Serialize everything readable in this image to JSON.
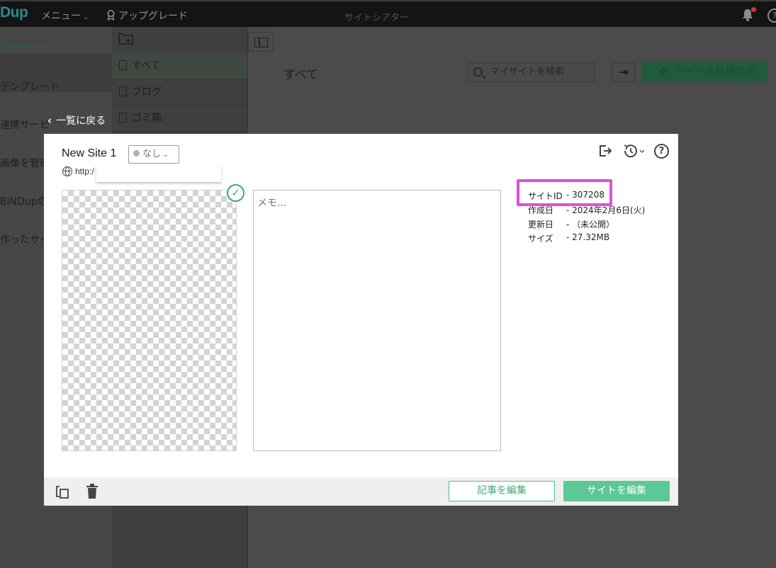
{
  "topbar": {
    "logo": "Dup",
    "menu_label": "メニュー",
    "upgrade_label": "アップグレード",
    "title": "サイトシアター",
    "help_symbol": "?"
  },
  "leftnav": {
    "items": [
      {
        "label": "マイサイト",
        "active": true
      },
      {
        "label": "テンプレート"
      },
      {
        "label": "連携サービ"
      },
      {
        "label": "画像を管理"
      },
      {
        "label": "BiNDupの"
      },
      {
        "label": "作ったサイ"
      }
    ]
  },
  "folders": {
    "items": [
      {
        "label": "すべて",
        "active": true
      },
      {
        "label": "ブログ"
      },
      {
        "label": "ゴミ箱"
      }
    ]
  },
  "main": {
    "title": "すべて",
    "search_placeholder": "マイサイトを検索",
    "new_site_label": "サイトを新規作成",
    "back_label": "一覧に戻る"
  },
  "modal": {
    "site_name": "New Site 1",
    "status": "なし",
    "url_prefix": "http:/",
    "memo_placeholder": "メモ...",
    "check_symbol": "✓",
    "help_symbol": "?",
    "info": [
      {
        "label": "サイトID",
        "value": "- 307208"
      },
      {
        "label": "作成日",
        "value": "- 2024年2月6日(火)"
      },
      {
        "label": "更新日",
        "value": "- （未公開）"
      },
      {
        "label": "サイズ",
        "value": "- 27.32MB"
      }
    ],
    "edit_articles_label": "記事を編集",
    "edit_site_label": "サイトを編集"
  },
  "colors": {
    "accent_green": "#5bc895",
    "highlight_magenta": "#e64bd9"
  }
}
